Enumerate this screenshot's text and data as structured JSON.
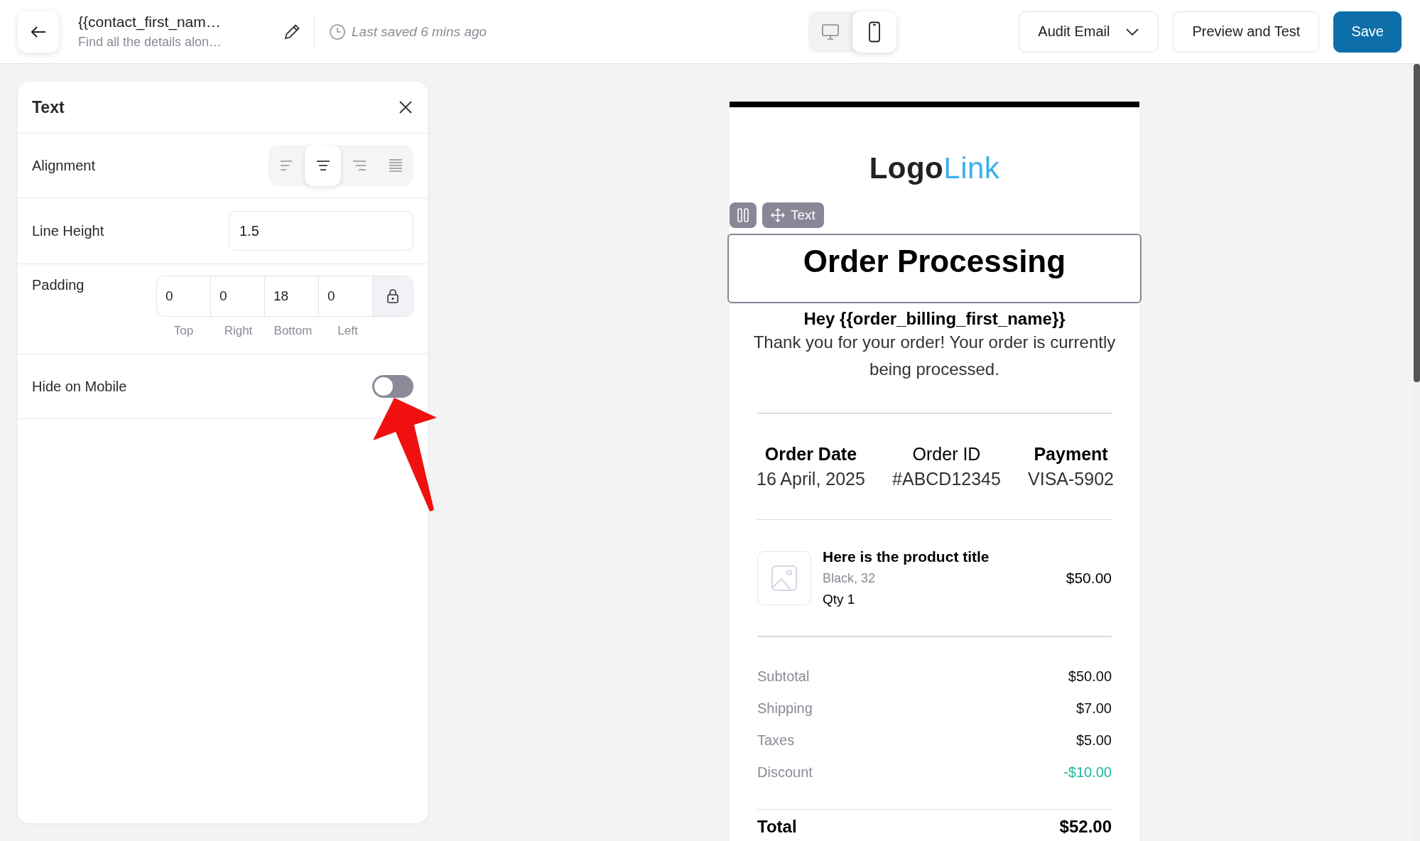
{
  "header": {
    "title": "{{contact_first_nam…",
    "subtitle": "Find all the details alon…",
    "saved_status": "Last saved 6 mins ago"
  },
  "device_toggle": [
    {
      "kind": "desktop",
      "selected": false
    },
    {
      "kind": "mobile",
      "selected": true
    }
  ],
  "actions": [
    {
      "label": "Audit Email",
      "kind": "dropdown"
    },
    {
      "label": "Preview and Test",
      "kind": "outline"
    },
    {
      "label": "Save",
      "kind": "primary"
    }
  ],
  "panel": {
    "title": "Text",
    "alignment": {
      "label": "Alignment",
      "options": [
        {
          "kind": "left",
          "selected": false
        },
        {
          "kind": "center",
          "selected": true
        },
        {
          "kind": "right",
          "selected": false
        },
        {
          "kind": "justify",
          "selected": false
        }
      ]
    },
    "line_height": {
      "label": "Line Height",
      "value": "1.5"
    },
    "padding": {
      "label": "Padding",
      "fields": [
        {
          "label": "Top",
          "value": "0"
        },
        {
          "label": "Right",
          "value": "0"
        },
        {
          "label": "Bottom",
          "value": "18"
        },
        {
          "label": "Left",
          "value": "0"
        }
      ]
    },
    "hide_on_mobile": {
      "label": "Hide on Mobile",
      "on": false
    }
  },
  "email": {
    "logo": {
      "dark": "Logo",
      "accent": "Link"
    },
    "block_tag": "Text",
    "heading": "Order Processing",
    "greeting": "Hey {{order_billing_first_name}}",
    "message": "Thank you for your order! Your order is currently being processed.",
    "order_info": [
      {
        "label": "Order Date",
        "value": "16 April, 2025",
        "bold": true
      },
      {
        "label": "Order ID",
        "value": "#ABCD12345",
        "bold": false
      },
      {
        "label": "Payment",
        "value": "VISA-5902",
        "bold": true
      }
    ],
    "product": {
      "title": "Here is the product title",
      "variant": "Black, 32",
      "quantity": "Qty 1",
      "price": "$50.00"
    },
    "totals": [
      {
        "label": "Subtotal",
        "value": "$50.00",
        "kind": "normal"
      },
      {
        "label": "Shipping",
        "value": "$7.00",
        "kind": "normal"
      },
      {
        "label": "Taxes",
        "value": "$5.00",
        "kind": "normal"
      },
      {
        "label": "Discount",
        "value": "-$10.00",
        "kind": "discount"
      }
    ],
    "total": {
      "label": "Total",
      "value": "$52.00"
    }
  }
}
